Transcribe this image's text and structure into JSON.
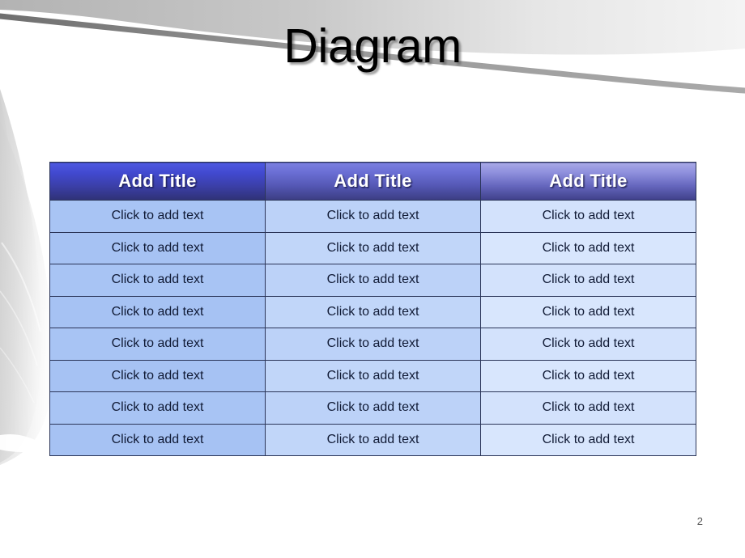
{
  "slide": {
    "title": "Diagram",
    "page_number": "2",
    "background_color": "#ffffff",
    "accent_color": "#3b3fa8",
    "swoosh_color": "#b7b7b7"
  },
  "table": {
    "headers": [
      {
        "label": "Add Title",
        "color": "#3b3fa8"
      },
      {
        "label": "Add Title",
        "color": "#5457b4"
      },
      {
        "label": "Add Title",
        "color": "#6566bd"
      }
    ],
    "rows": [
      [
        "Click to add text",
        "Click to add text",
        "Click to add text"
      ],
      [
        "Click to add text",
        "Click to add text",
        "Click to add text"
      ],
      [
        "Click to add text",
        "Click to add text",
        "Click to add text"
      ],
      [
        "Click to add text",
        "Click to add text",
        "Click to add text"
      ],
      [
        "Click to add text",
        "Click to add text",
        "Click to add text"
      ],
      [
        "Click to add text",
        "Click to add text",
        "Click to add text"
      ],
      [
        "Click to add text",
        "Click to add text",
        "Click to add text"
      ],
      [
        "Click to add text",
        "Click to add text",
        "Click to add text"
      ]
    ]
  }
}
